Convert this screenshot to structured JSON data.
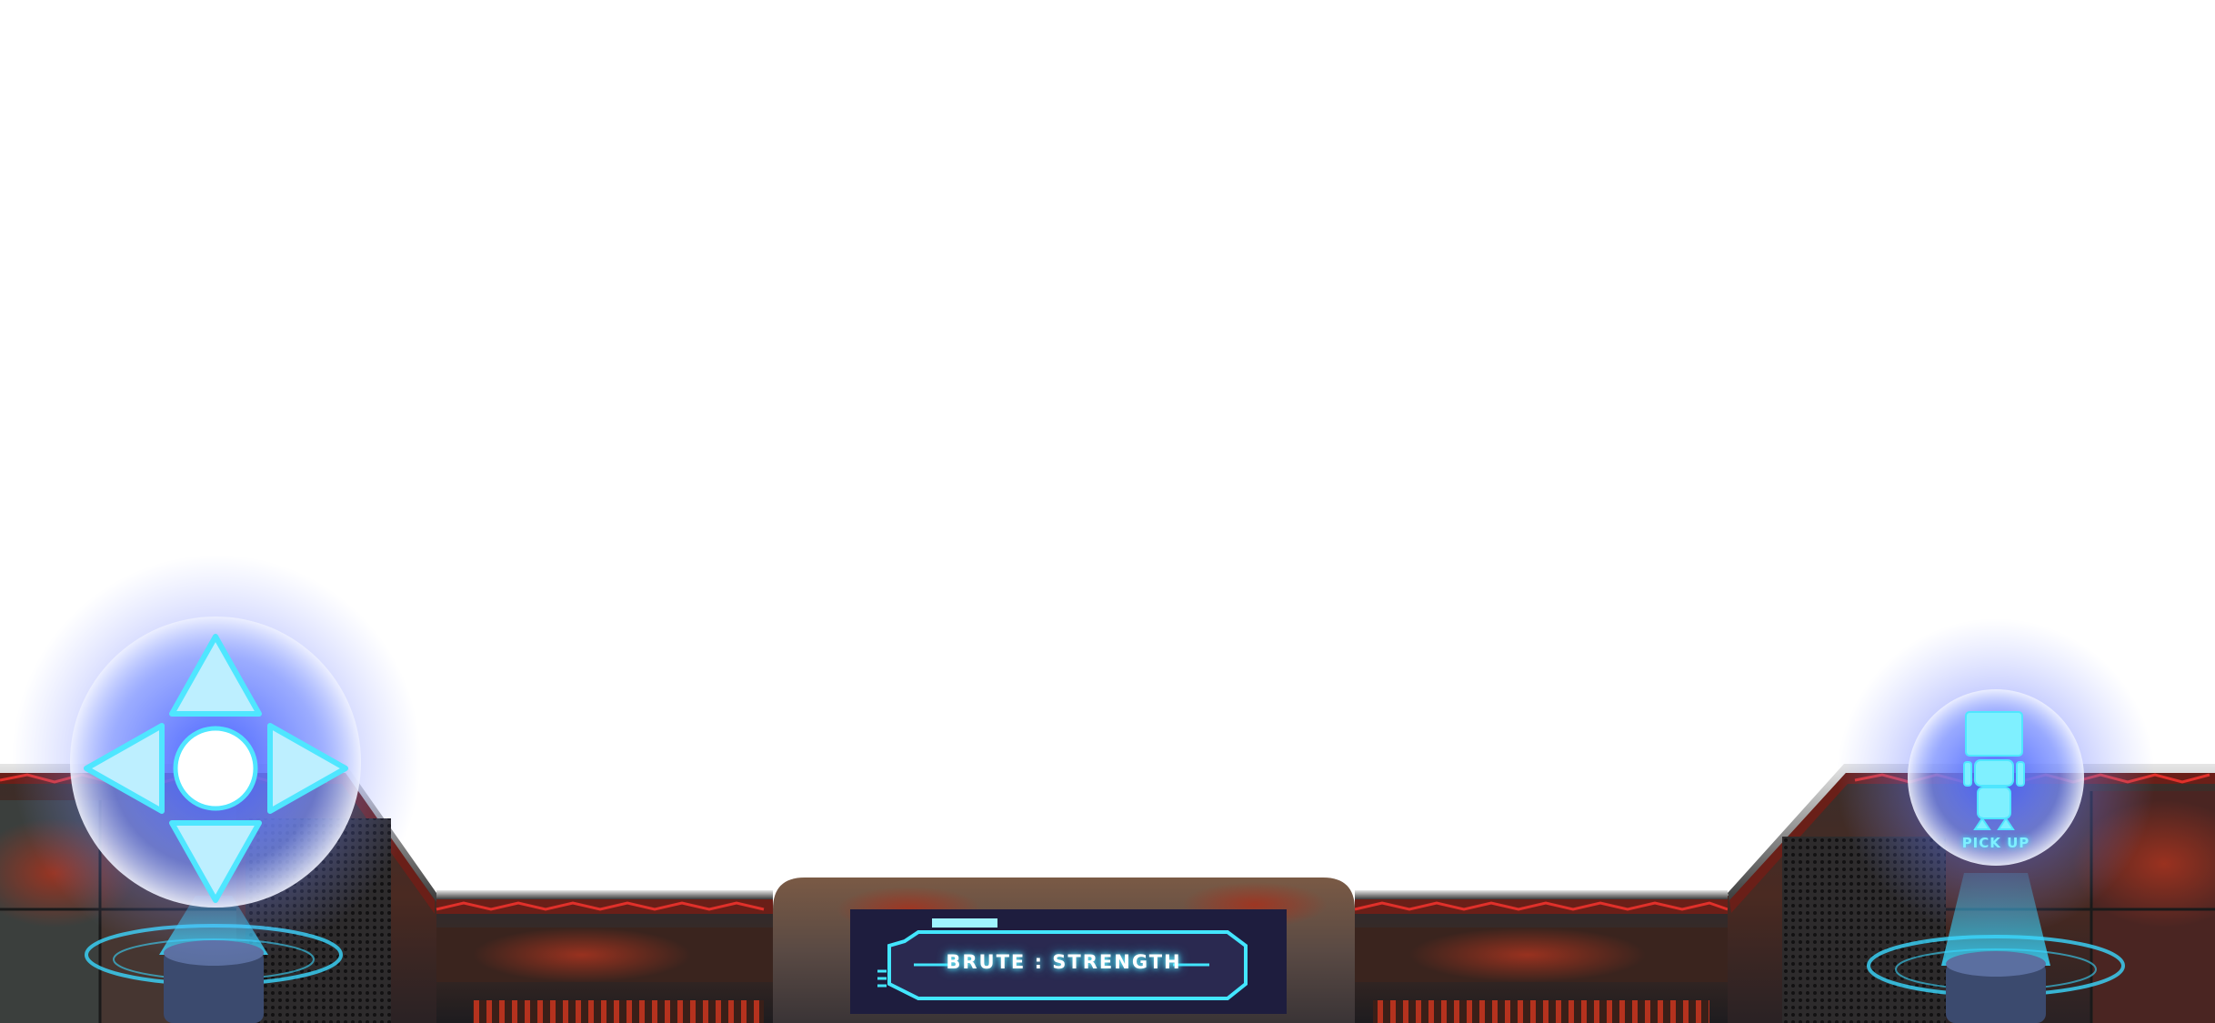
{
  "hud": {
    "console_label": "BRUTE : STRENGTH",
    "pickup_label": "PICK UP"
  },
  "controls": {
    "dpad": {
      "buttons": [
        "up-arrow-icon",
        "down-arrow-icon",
        "left-arrow-icon",
        "right-arrow-icon",
        "center-circle-icon"
      ]
    },
    "pickup_button": {
      "icon": "robot-icon"
    }
  },
  "colors": {
    "hologram_cyan": "#4fe6ff",
    "glow_blue": "#5a6cff",
    "wall_red": "#c0261d",
    "metal_dark": "#2b2a2c",
    "panel_navy": "#1e1d3e"
  }
}
